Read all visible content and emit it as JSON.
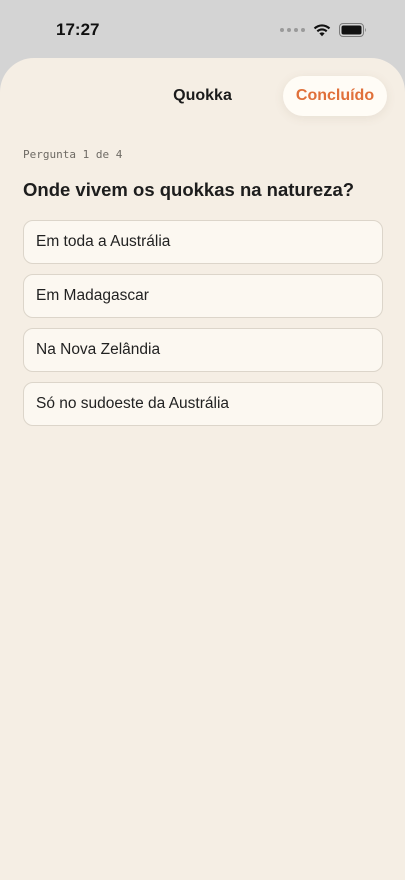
{
  "status_bar": {
    "time": "17:27"
  },
  "header": {
    "title": "Quokka",
    "done_label": "Concluído"
  },
  "quiz": {
    "counter": "Pergunta 1 de 4",
    "question": "Onde vivem os quokkas na natureza?",
    "options": [
      {
        "label": "Em toda a Austrália"
      },
      {
        "label": "Em Madagascar"
      },
      {
        "label": "Na Nova Zelândia"
      },
      {
        "label": "Só no sudoeste da Austrália"
      }
    ]
  },
  "colors": {
    "sheet_background": "#f5eee4",
    "accent": "#e0703a",
    "option_background": "#fcf8f1",
    "option_border": "#dcd5ca"
  }
}
